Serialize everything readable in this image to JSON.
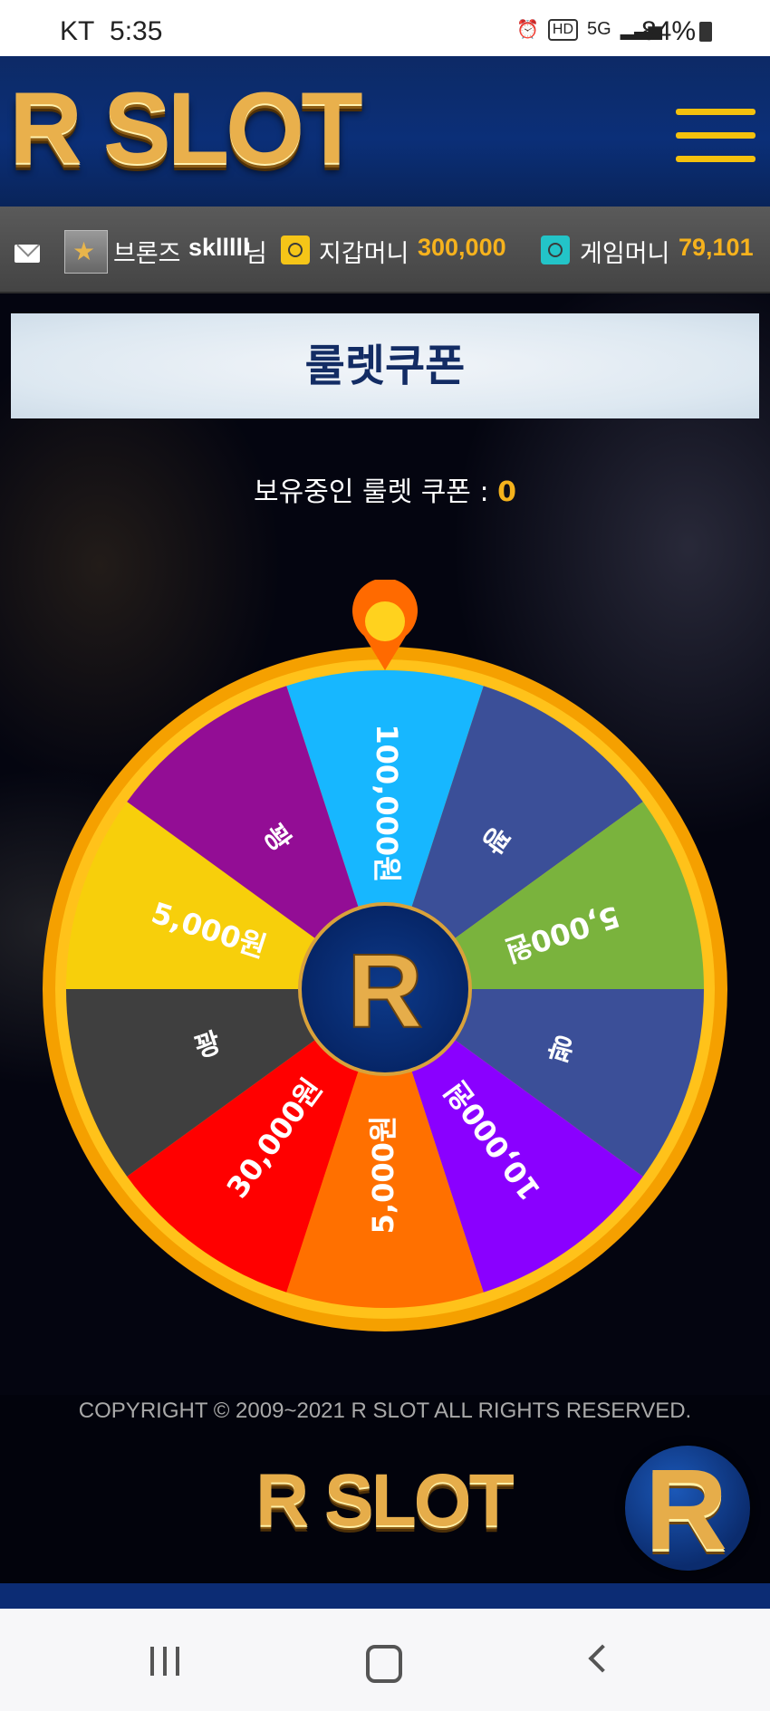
{
  "status_bar": {
    "carrier": "KT",
    "time": "5:35",
    "hd_label": "HD",
    "network": "5G",
    "battery": "84%",
    "alarm_icon": "alarm-icon",
    "signal_icon": "signal-icon",
    "battery_icon": "battery-icon"
  },
  "header": {
    "logo": "R SLOT",
    "menu_icon": "hamburger-menu-icon"
  },
  "user_bar": {
    "mail_icon": "mail-icon",
    "rank": "브론즈",
    "username": "sklllll",
    "honorific": "님",
    "wallet_label": "지갑머니",
    "wallet_value": "300,000",
    "game_label": "게임머니",
    "game_value": "79,101"
  },
  "page": {
    "title": "룰렛쿠폰",
    "coupon_label": "보유중인 룰렛 쿠폰 :",
    "coupon_count": "0"
  },
  "wheel": {
    "center_logo": "R",
    "pointer_icon": "pointer-pin-icon",
    "segments": [
      {
        "label": "100,000원",
        "color": "#17b7ff"
      },
      {
        "label": "꽝",
        "color": "#3b4f98"
      },
      {
        "label": "5,000원",
        "color": "#7ab33d"
      },
      {
        "label": "꽝",
        "color": "#3b4f98"
      },
      {
        "label": "10,000원",
        "color": "#8a00ff"
      },
      {
        "label": "5,000원",
        "color": "#ff7000"
      },
      {
        "label": "30,000원",
        "color": "#ff0000"
      },
      {
        "label": "꽝",
        "color": "#3f3f3f"
      },
      {
        "label": "5,000원",
        "color": "#f7cf0b"
      },
      {
        "label": "꽝",
        "color": "#930d95"
      }
    ]
  },
  "footer": {
    "copyright": "COPYRIGHT © 2009~2021 R SLOT ALL RIGHTS RESERVED.",
    "logo": "R SLOT",
    "float_logo": "R"
  },
  "nav": {
    "recent_icon": "recent-apps-icon",
    "home_icon": "home-icon",
    "back_icon": "back-icon"
  }
}
